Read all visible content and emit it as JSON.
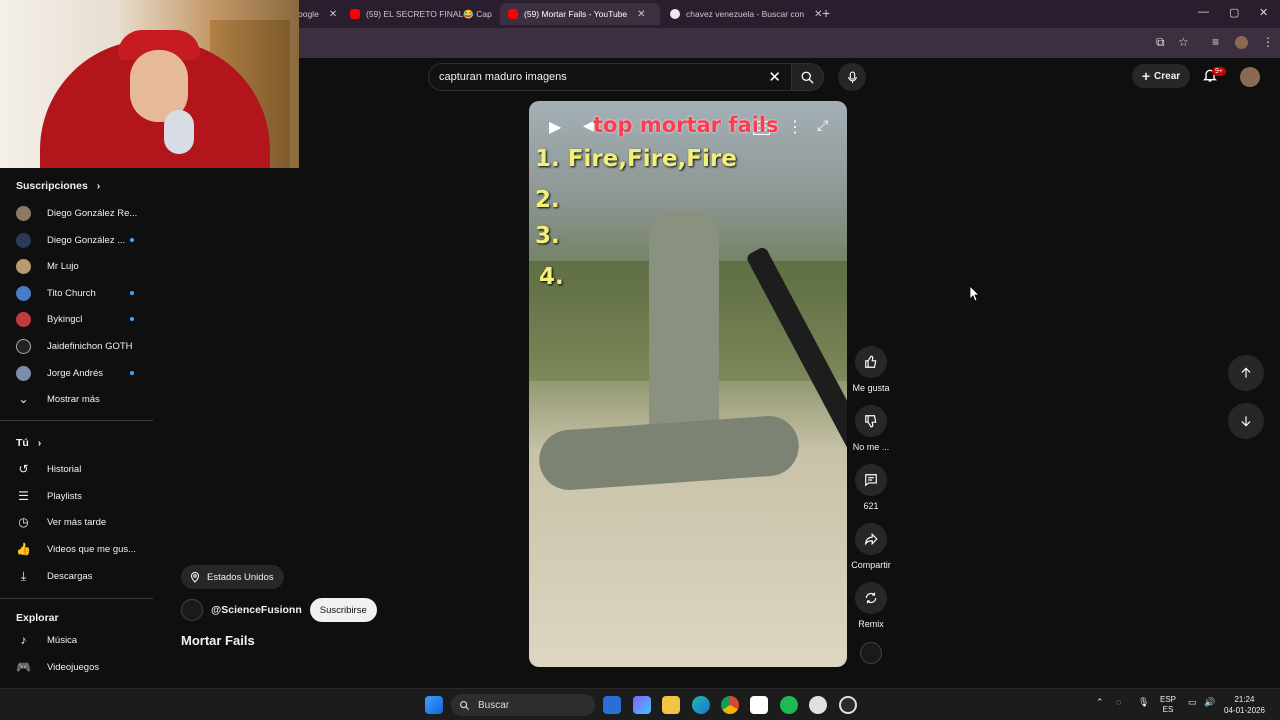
{
  "browser": {
    "tabs": [
      {
        "title": "oogle",
        "color": "#4285f4"
      },
      {
        "title": "(59) EL SECRETO FINAL😂 Cap",
        "color": "#ff0000"
      },
      {
        "title": "(59) Mortar Fails - YouTube",
        "color": "#ff0000"
      },
      {
        "title": "chavez venezuela - Buscar con",
        "color": "#4285f4"
      }
    ],
    "new_tab": "+",
    "tab_close": "✕",
    "window_controls": [
      "—",
      "▢",
      "✕"
    ]
  },
  "header": {
    "search_value": "capturan maduro imagens",
    "clear": "✕",
    "create_label": "Crear",
    "notification_count": "9+"
  },
  "sidebar": {
    "subs_title": "Suscripciones",
    "subs": [
      {
        "name": "Diego González Re...",
        "color": "#8a7a62",
        "dot": false
      },
      {
        "name": "Diego González ...",
        "color": "#2b3a55",
        "dot": true
      },
      {
        "name": "Mr Lujo",
        "color": "#b89a6e",
        "dot": false
      },
      {
        "name": "Tito Church",
        "color": "#4a7bc8",
        "dot": true
      },
      {
        "name": "Bykingcl",
        "color": "#c23a3a",
        "dot": true
      },
      {
        "name": "Jaidefinichon GOTH",
        "color": "#222222",
        "dot": false
      },
      {
        "name": "Jorge Andrés",
        "color": "#7a8ea8",
        "dot": true
      }
    ],
    "show_more": "Mostrar más",
    "you_title": "Tú",
    "you_items": [
      {
        "label": "Historial",
        "icon": "↺"
      },
      {
        "label": "Playlists",
        "icon": "☰"
      },
      {
        "label": "Ver más tarde",
        "icon": "◷"
      },
      {
        "label": "Videos que me gus...",
        "icon": "👍"
      },
      {
        "label": "Descargas",
        "icon": "⤓"
      }
    ],
    "explore_title": "Explorar",
    "explore_items": [
      {
        "label": "Música",
        "icon": "♪"
      },
      {
        "label": "Videojuegos",
        "icon": "🎮"
      }
    ]
  },
  "video": {
    "overlay_title": "top mortar fails",
    "lines": [
      "1. Fire,Fire,Fire",
      "2.",
      "3.",
      "4."
    ]
  },
  "actions": {
    "like": "Me gusta",
    "dislike": "No me ...",
    "comments": "621",
    "share": "Compartir",
    "remix": "Remix"
  },
  "channel": {
    "location": "Estados Unidos",
    "handle": "@ScienceFusionn",
    "subscribe": "Suscribirse",
    "title": "Mortar Fails"
  },
  "taskbar": {
    "search_label": "Buscar",
    "lang_1": "ESP",
    "lang_2": "ES",
    "time": "21:24",
    "date": "04-01-2026"
  }
}
